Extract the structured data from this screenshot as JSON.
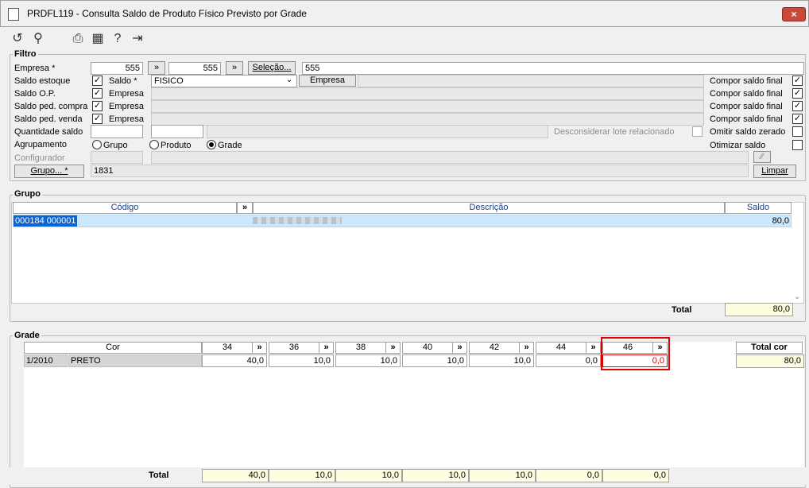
{
  "window": {
    "title": "PRDFL119 - Consulta Saldo de Produto Físico Previsto por Grade",
    "close_label": "×"
  },
  "toolbar": {
    "icons": [
      "refresh-icon",
      "search-icon",
      "print-icon",
      "calendar-icon",
      "help-icon",
      "exit-icon"
    ]
  },
  "filtro": {
    "title": "Filtro",
    "empresa_label": "Empresa *",
    "empresa_from": "555",
    "empresa_to": "555",
    "arrow": "»",
    "selecao_label": "Seleção...",
    "empresa_desc": "555",
    "saldo_estoque_label": "Saldo estoque",
    "saldo_label": "Saldo *",
    "saldo_value": "FISICO",
    "empresa_header": "Empresa",
    "saldo_op_label": "Saldo O.P.",
    "saldo_ped_compra_label": "Saldo ped. compra",
    "saldo_ped_venda_label": "Saldo ped. venda",
    "empresa_text": "Empresa",
    "compor_saldo_final": "Compor saldo final",
    "quantidade_saldo_label": "Quantidade saldo",
    "desconsiderar_label": "Desconsiderar lote relacionado",
    "omitir_label": "Omitir saldo zerado",
    "agrupamento_label": "Agrupamento",
    "opt_grupo": "Grupo",
    "opt_produto": "Produto",
    "opt_grade": "Grade",
    "otimizar_label": "Otimizar saldo",
    "configurador_label": "Configurador",
    "grupo_btn": "Grupo... *",
    "grupo_value": "1831",
    "limpar_label": "Limpar"
  },
  "grupo": {
    "title": "Grupo",
    "col_codigo": "Código",
    "col_descricao": "Descrição",
    "col_saldo": "Saldo",
    "arrow": "»",
    "row_codigo": "000184 000001",
    "row_saldo": "80,0",
    "total_label": "Total",
    "total_value": "80,0"
  },
  "grade": {
    "title": "Grade",
    "col_cor": "Cor",
    "sizes": [
      "34",
      "36",
      "38",
      "40",
      "42",
      "44",
      "46"
    ],
    "arrow": "»",
    "row_code": "1/2010",
    "row_cor": "PRETO",
    "values": [
      "40,0",
      "10,0",
      "10,0",
      "10,0",
      "10,0",
      "0,0",
      "0,0"
    ],
    "total_cor_label": "Total cor",
    "total_cor_value": "80,0",
    "total_label": "Total",
    "totals": [
      "40,0",
      "10,0",
      "10,0",
      "10,0",
      "10,0",
      "0,0",
      "0,0"
    ]
  },
  "colors": {
    "accent_highlight": "#cce8ff",
    "selected_border": "#dd0000",
    "total_bg": "#fffde0"
  }
}
